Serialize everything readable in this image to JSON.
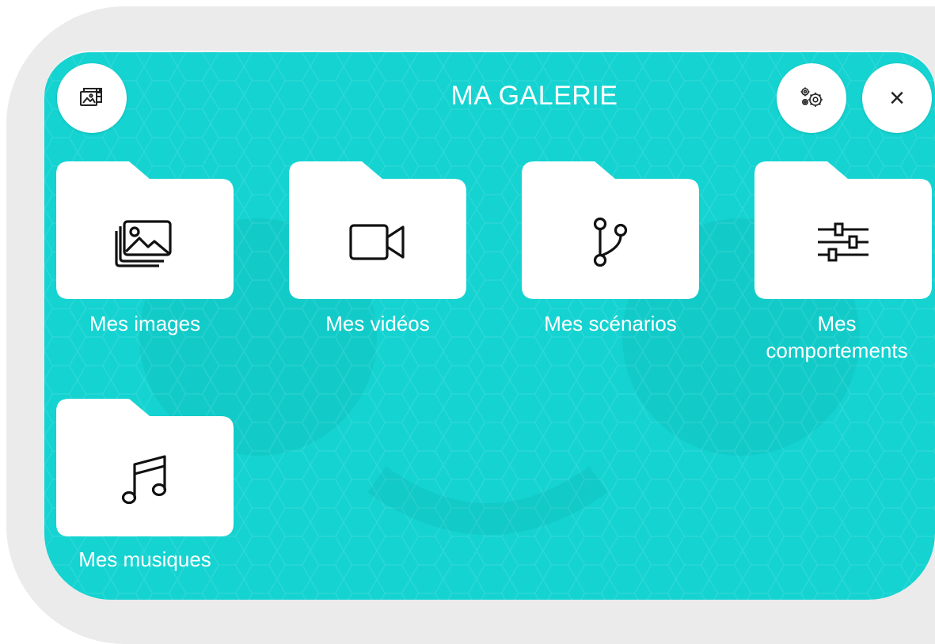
{
  "header": {
    "title": "MA GALERIE",
    "gallery_icon": "gallery-icon",
    "settings_icon": "gears-icon",
    "close_icon": "close-icon",
    "close_glyph": "×"
  },
  "folders": [
    {
      "label": "Mes images",
      "icon": "images-icon"
    },
    {
      "label": "Mes vidéos",
      "icon": "video-camera-icon"
    },
    {
      "label": "Mes scénarios",
      "icon": "branch-icon"
    },
    {
      "label_line1": "Mes",
      "label_line2": "comportements",
      "icon": "sliders-icon"
    },
    {
      "label": "Mes musiques",
      "icon": "music-note-icon"
    }
  ],
  "colors": {
    "screen": "#14d3d1",
    "frame": "#ebebeb",
    "folder": "#ffffff",
    "text": "#ffffff"
  }
}
